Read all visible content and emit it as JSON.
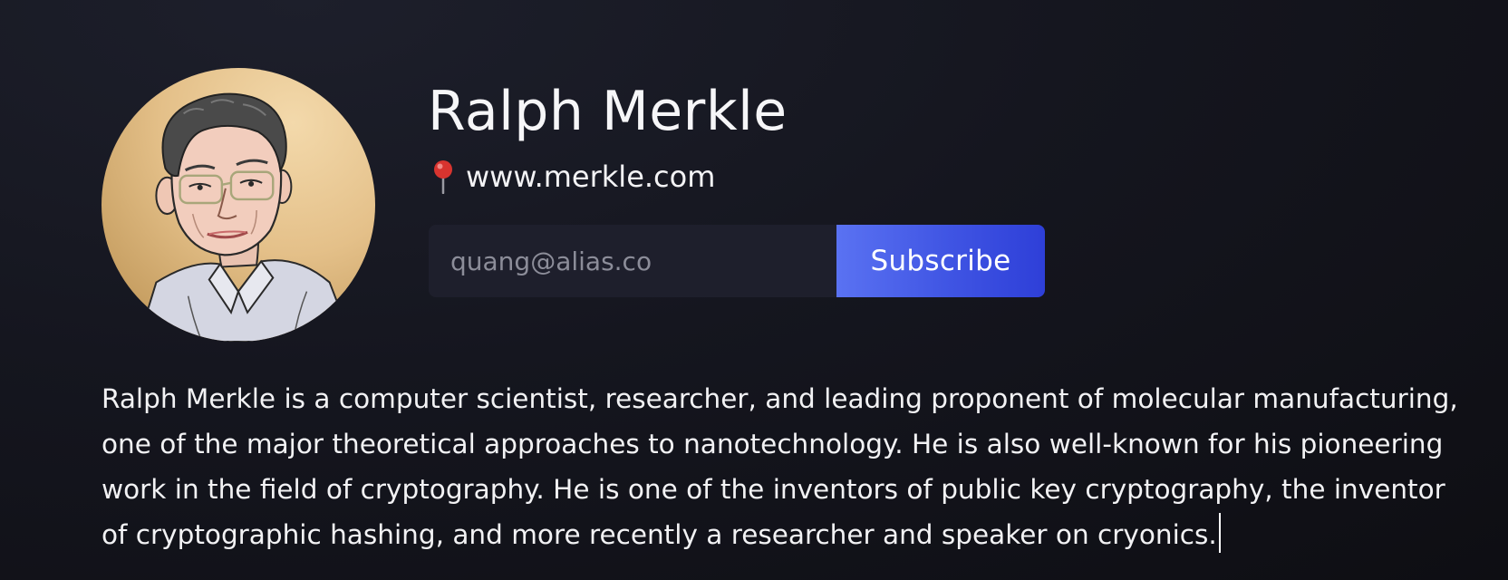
{
  "profile": {
    "name": "Ralph Merkle",
    "website": "www.merkle.com",
    "subscribe": {
      "email_value": "",
      "email_placeholder": "quang@alias.co",
      "button_label": "Subscribe"
    },
    "bio": "Ralph Merkle is a computer scientist, researcher, and leading proponent of molecular manufacturing, one of the major theoretical approaches to nanotechnology. He is also well-known for his pioneering work in the field of cryptography. He is one of the inventors of public key cryptography, the inventor of cryptographic hashing, and more recently a researcher and speaker on cryonics."
  },
  "icons": {
    "location": "map-pin-icon",
    "avatar": "portrait-illustration"
  },
  "colors": {
    "background": "#13141c",
    "accent_start": "#5a72f2",
    "accent_end": "#2e3fd8",
    "input_bg": "#1e1f2c",
    "avatar_bg": "#e4c089",
    "pin": "#d8342f"
  }
}
